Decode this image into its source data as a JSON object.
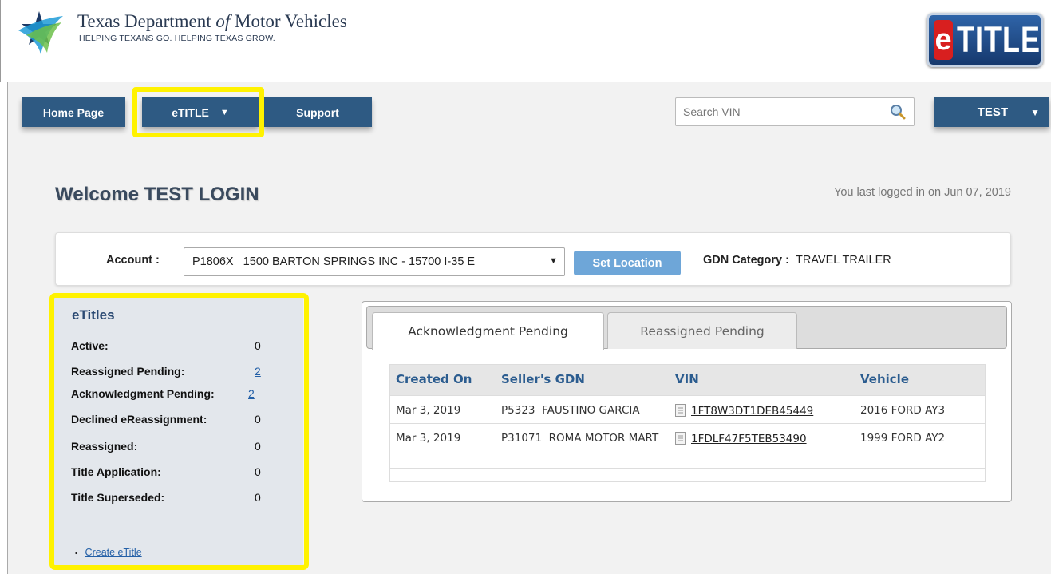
{
  "header": {
    "org_name_part1": "Texas Department ",
    "org_name_of": "of",
    "org_name_part2": " Motor Vehicles",
    "tagline": "HELPING TEXANS GO. HELPING TEXAS GROW.",
    "product_logo_e": "e",
    "product_logo_text": "TITLE"
  },
  "nav": {
    "home": "Home Page",
    "etitle": "eTITLE",
    "support": "Support",
    "caret": "▼"
  },
  "search": {
    "placeholder": "Search VIN"
  },
  "user_menu": {
    "label": "TEST",
    "caret": "▼"
  },
  "welcome": {
    "title": "Welcome TEST LOGIN",
    "last_login": "You last logged in on Jun 07, 2019"
  },
  "account": {
    "label": "Account :",
    "selected": "P1806X   1500 BARTON SPRINGS INC - 15700 I-35 E",
    "caret": "▼",
    "set_location": "Set Location",
    "gdn_label": "GDN Category :",
    "gdn_value": "TRAVEL TRAILER"
  },
  "etitles": {
    "title": "eTitles",
    "stats": [
      {
        "label": "Active:",
        "value": "0"
      },
      {
        "label": "Reassigned Pending:",
        "value": "2"
      },
      {
        "label": "Acknowledgment Pending:",
        "value": "2"
      },
      {
        "label": "Declined eReassignment:",
        "value": "0"
      },
      {
        "label": "Reassigned:",
        "value": "0"
      },
      {
        "label": "Title Application:",
        "value": "0"
      },
      {
        "label": "Title Superseded:",
        "value": "0"
      }
    ],
    "create_link": "Create eTitle"
  },
  "tabs": [
    {
      "label": "Acknowledgment Pending",
      "active": true
    },
    {
      "label": "Reassigned Pending",
      "active": false
    }
  ],
  "table": {
    "headers": [
      "Created On",
      "Seller's GDN",
      "VIN",
      "Vehicle"
    ],
    "rows": [
      {
        "created": "Mar 3, 2019",
        "seller": "P5323  FAUSTINO GARCIA",
        "vin": "1FT8W3DT1DEB45449",
        "vehicle": "2016 FORD AY3"
      },
      {
        "created": "Mar 3, 2019",
        "seller": "P31071  ROMA MOTOR MART",
        "vin": "1FDLF47F5TEB53490",
        "vehicle": "1999 FORD AY2"
      }
    ]
  },
  "colors": {
    "nav_blue": "#2e5a83",
    "highlight_yellow": "#fff200",
    "link_blue": "#2460a7",
    "set_location_blue": "#6ea6d8"
  }
}
